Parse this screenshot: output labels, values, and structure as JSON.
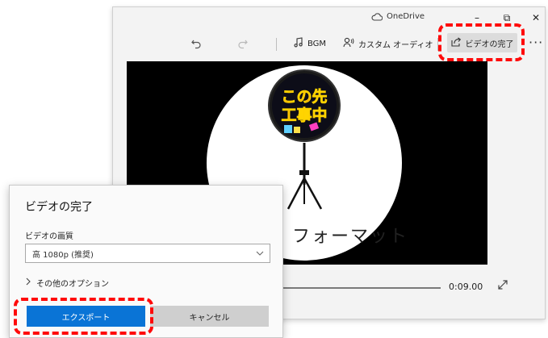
{
  "titlebar": {
    "onedrive_label": "OneDrive",
    "minimize_glyph": "–",
    "maximize_glyph": "⧉",
    "close_glyph": "✕"
  },
  "toolbar": {
    "bgm_label": "BGM",
    "custom_audio_label": "カスタム オーディオ",
    "finish_video_label": "ビデオの完了",
    "more_glyph": "···"
  },
  "preview": {
    "overlay_text": "フォーマット",
    "sign_text_line1": "この先",
    "sign_text_line2": "工事中"
  },
  "timeline": {
    "duration": "0:09.00"
  },
  "dialog": {
    "title": "ビデオの完了",
    "quality_label": "ビデオの画質",
    "quality_value": "高 1080p (推奨)",
    "more_options_label": "その他のオプション",
    "export_label": "エクスポート",
    "cancel_label": "キャンセル"
  },
  "colors": {
    "accent": "#0a74d6",
    "highlight": "#ff0a0a",
    "preview_bg": "#000000"
  }
}
